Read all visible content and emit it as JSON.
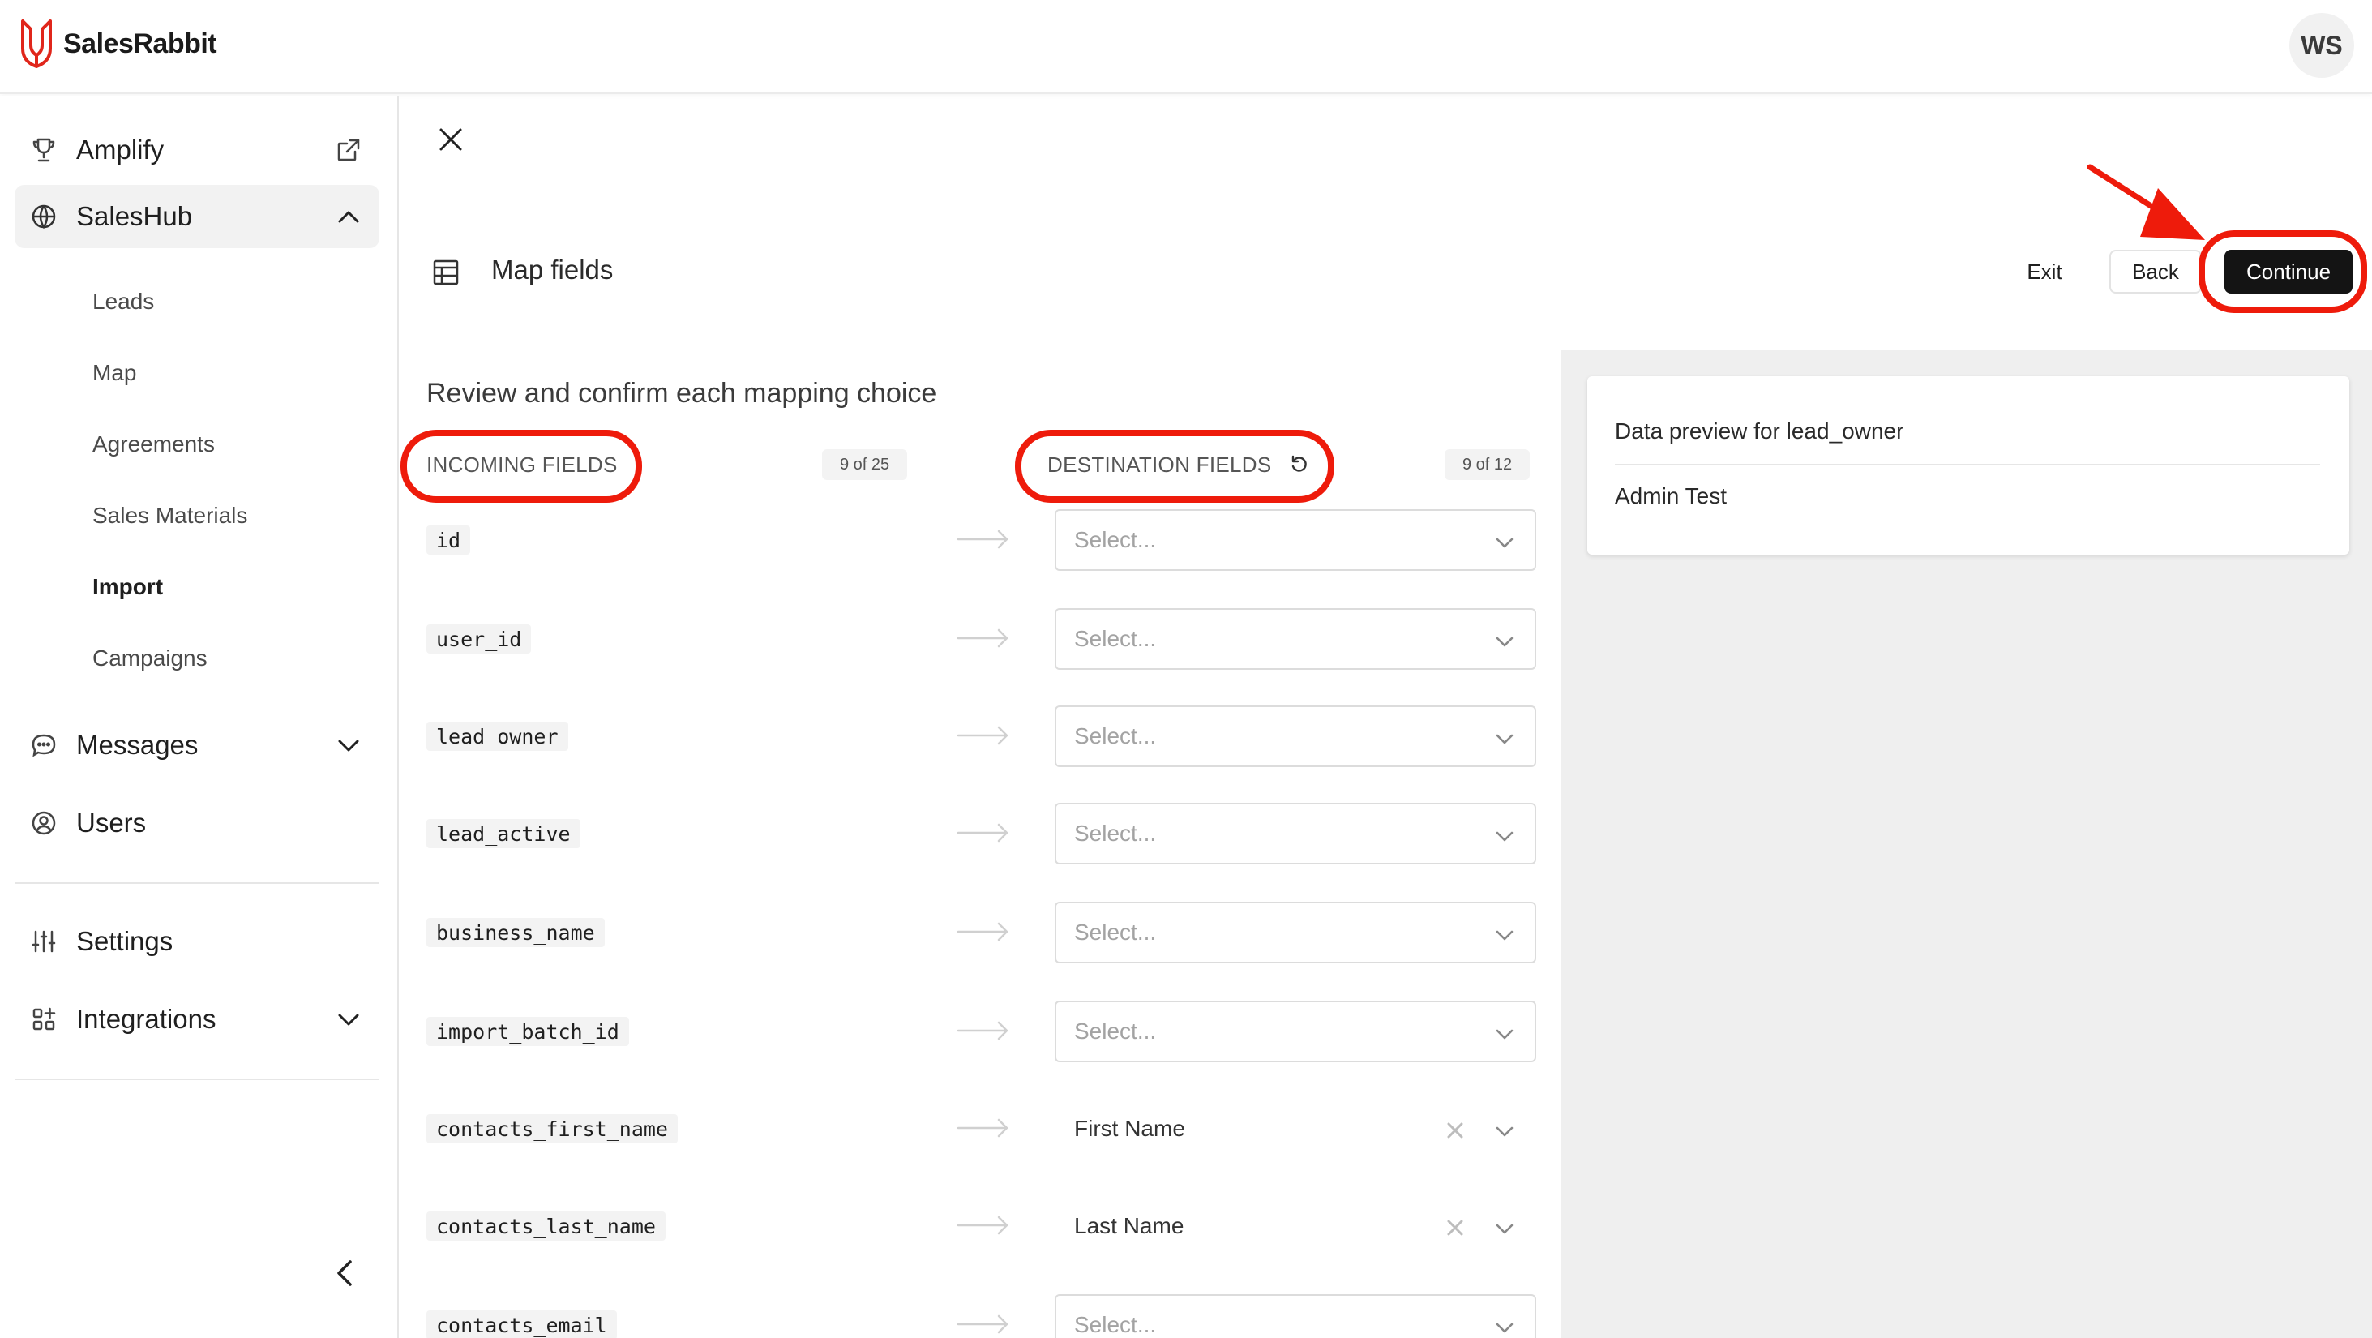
{
  "app": {
    "brand": "SalesRabbit",
    "user_initials": "WS",
    "brand_color": "#e0261b"
  },
  "sidebar": {
    "items": [
      {
        "label": "Amplify",
        "icon": "trophy-icon",
        "trail": "external-link-icon"
      },
      {
        "label": "SalesHub",
        "icon": "globe-icon",
        "trail": "chevron-up-icon",
        "active": true
      },
      {
        "label": "Messages",
        "icon": "chat-icon",
        "trail": "chevron-down-icon"
      },
      {
        "label": "Users",
        "icon": "user-circle-icon"
      },
      {
        "label": "Settings",
        "icon": "sliders-icon"
      },
      {
        "label": "Integrations",
        "icon": "grid-plus-icon",
        "trail": "chevron-down-icon"
      }
    ],
    "saleshub_sub": [
      "Leads",
      "Map",
      "Agreements",
      "Sales Materials",
      "Import",
      "Campaigns"
    ],
    "current_sub": "Import"
  },
  "header": {
    "title": "Map fields",
    "exit_label": "Exit",
    "back_label": "Back",
    "continue_label": "Continue"
  },
  "mapping": {
    "heading": "Review and confirm each mapping choice",
    "incoming_label": "INCOMING FIELDS",
    "incoming_count": "9 of 25",
    "destination_label": "DESTINATION FIELDS",
    "destination_count": "9 of 12",
    "placeholder": "Select...",
    "rows": [
      {
        "field": "id",
        "value": ""
      },
      {
        "field": "user_id",
        "value": ""
      },
      {
        "field": "lead_owner",
        "value": ""
      },
      {
        "field": "lead_active",
        "value": ""
      },
      {
        "field": "business_name",
        "value": ""
      },
      {
        "field": "import_batch_id",
        "value": ""
      },
      {
        "field": "contacts_first_name",
        "value": "First Name"
      },
      {
        "field": "contacts_last_name",
        "value": "Last Name"
      },
      {
        "field": "contacts_email",
        "value": ""
      }
    ]
  },
  "preview": {
    "title": "Data preview for lead_owner",
    "value": "Admin Test"
  },
  "annotation_color": "#ee1b0b"
}
